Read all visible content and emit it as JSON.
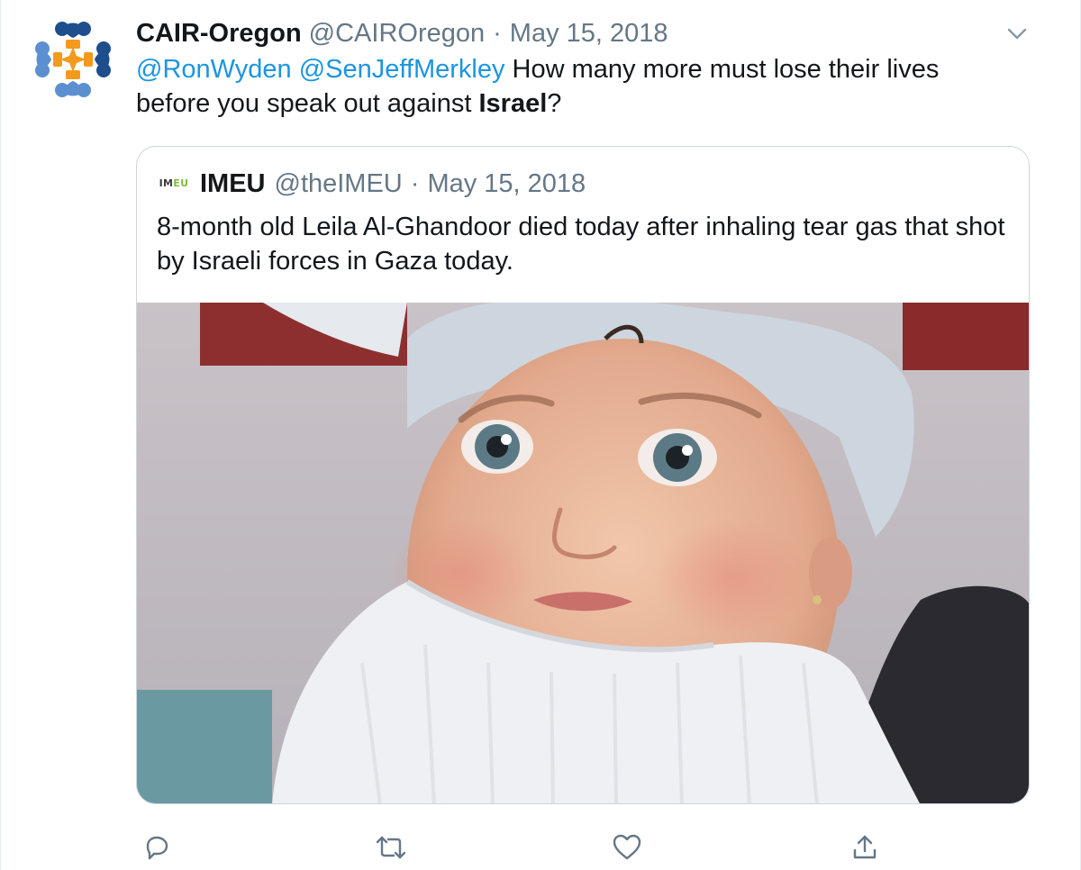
{
  "author": {
    "display_name": "CAIR-Oregon",
    "handle": "@CAIROregon",
    "separator": "·",
    "date": "May 15, 2018",
    "avatar_icon": "cair-logo-icon"
  },
  "tweet": {
    "mention_1": "@RonWyden",
    "mention_2": "@SenJeffMerkley",
    "text_part_1": " How many more must lose their lives before you speak out against ",
    "bold_word": "Israel",
    "text_part_2": "?"
  },
  "quoted": {
    "logo_text_1": "IM",
    "logo_text_2": "EU",
    "display_name": "IMEU",
    "handle": "@theIMEU",
    "separator": "·",
    "date": "May 15, 2018",
    "text": "8-month old Leila Al-Ghandoor died today after inhaling tear gas that shot by Israeli forces in Gaza today."
  },
  "actions": {
    "reply_icon": "reply-icon",
    "retweet_icon": "retweet-icon",
    "like_icon": "heart-icon",
    "share_icon": "share-icon"
  },
  "colors": {
    "link": "#1b95e0",
    "secondary_text": "#657786",
    "border": "#ccd6dd",
    "cair_blue": "#1f4e8c",
    "cair_orange": "#f39a1e",
    "cair_light_blue": "#5b8fd0"
  }
}
